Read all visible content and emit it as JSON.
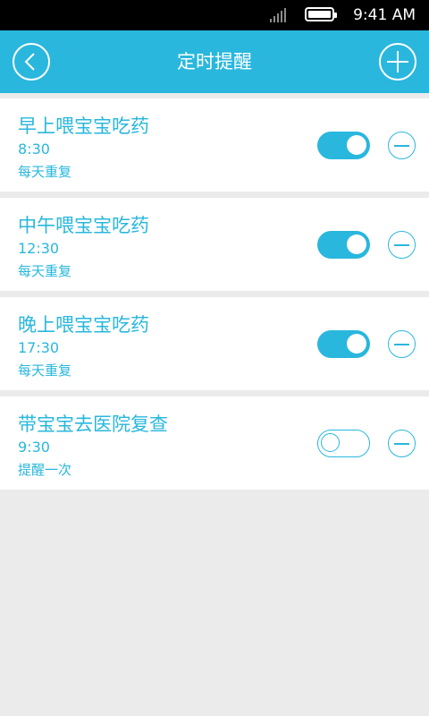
{
  "status_bar": {
    "time": "9:41 AM",
    "icons": [
      "signal-icon",
      "battery-icon"
    ]
  },
  "header": {
    "title": "定时提醒",
    "back_icon": "chevron-left-icon",
    "add_icon": "plus-icon"
  },
  "colors": {
    "accent": "#29b7dd",
    "background": "#ebebeb",
    "card": "#ffffff",
    "status_bar": "#000000"
  },
  "reminders": [
    {
      "title": "早上喂宝宝吃药",
      "time": "8:30",
      "repeat": "每天重复",
      "enabled": true
    },
    {
      "title": "中午喂宝宝吃药",
      "time": "12:30",
      "repeat": "每天重复",
      "enabled": true
    },
    {
      "title": "晚上喂宝宝吃药",
      "time": "17:30",
      "repeat": "每天重复",
      "enabled": true
    },
    {
      "title": "带宝宝去医院复查",
      "time": "9:30",
      "repeat": "提醒一次",
      "enabled": false
    }
  ]
}
